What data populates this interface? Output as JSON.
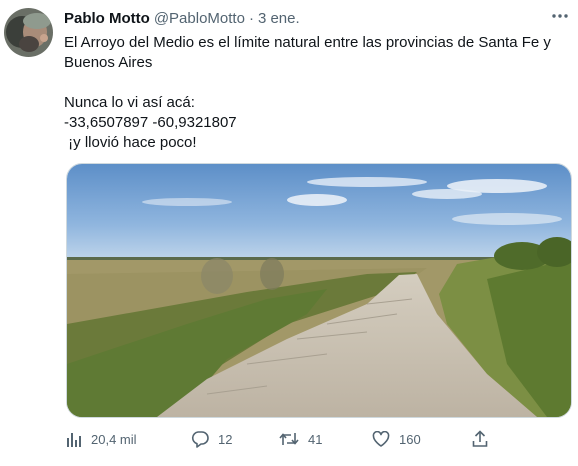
{
  "tweet": {
    "author_name": "Pablo Motto",
    "author_handle": "@PabloMotto",
    "separator": "·",
    "date": "3 ene.",
    "text_lines": [
      "El Arroyo del Medio es el límite natural entre las provincias de Santa Fe y",
      "Buenos Aires",
      "",
      "Nunca lo vi así acá:",
      "-33,6507897 -60,9321807",
      " ¡y llovió hace poco!"
    ],
    "media_description": "dry riverbed",
    "stats": {
      "views": "20,4 mil",
      "replies": "12",
      "retweets": "41",
      "likes": "160"
    }
  },
  "icons": {
    "more": "more-dots-icon",
    "views": "bar-chart-icon",
    "reply": "speech-bubble-icon",
    "retweet": "retweet-arrows-icon",
    "like": "heart-icon",
    "share": "share-upload-icon"
  },
  "colors": {
    "text_primary": "#0f1419",
    "text_secondary": "#536471",
    "border": "#cfd9de"
  }
}
